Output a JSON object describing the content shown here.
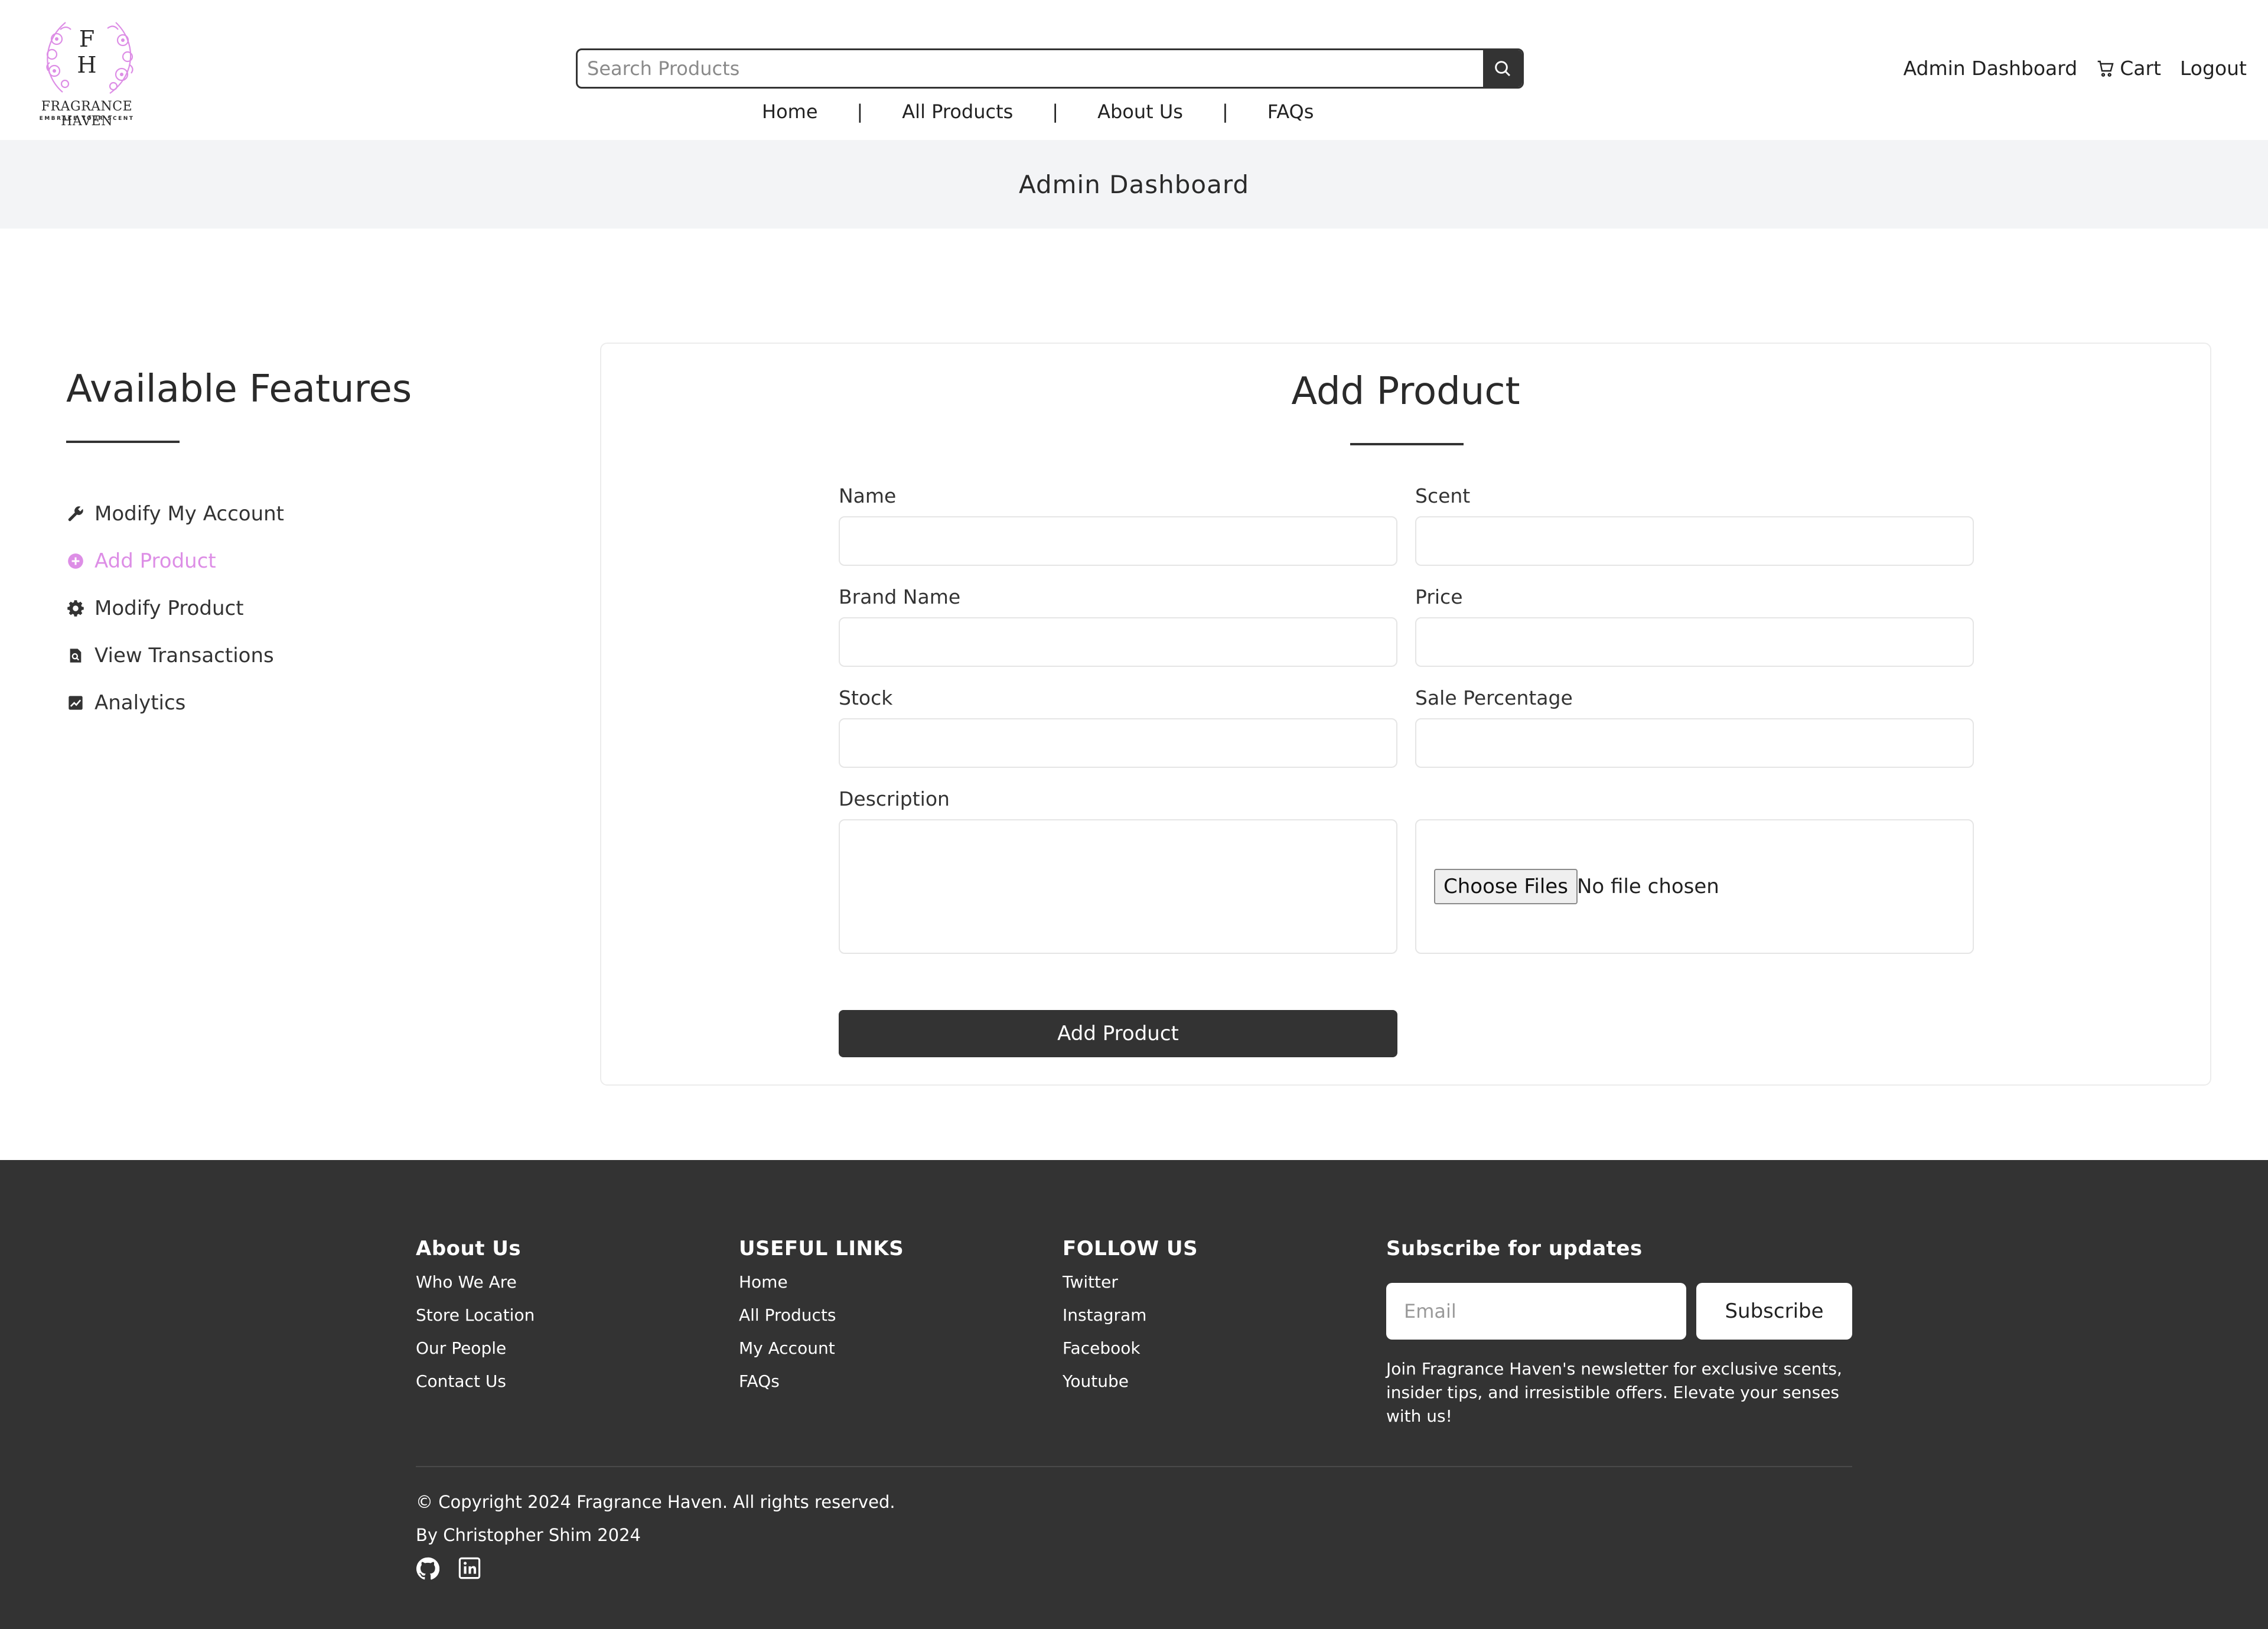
{
  "header": {
    "logo": {
      "mono_top": "F",
      "mono_bottom": "H",
      "brand": "FRAGRANCE HAVEN",
      "tagline": "EMBRACE YOUR SCENT",
      "icon": "floral-wreath-icon",
      "accent": "#dd8ee6"
    },
    "search": {
      "placeholder": "Search Products",
      "icon": "search-icon"
    },
    "nav": {
      "home": "Home",
      "all_products": "All Products",
      "about": "About Us",
      "faqs": "FAQs",
      "separator": "|"
    },
    "right": {
      "admin": "Admin Dashboard",
      "cart": "Cart",
      "cart_icon": "cart-icon",
      "logout": "Logout"
    }
  },
  "page_title": "Admin Dashboard",
  "sidebar": {
    "title": "Available Features",
    "items": [
      {
        "label": "Modify My Account",
        "icon": "wrench-icon",
        "active": false
      },
      {
        "label": "Add Product",
        "icon": "plus-circle-icon",
        "active": true
      },
      {
        "label": "Modify Product",
        "icon": "gear-icon",
        "active": false
      },
      {
        "label": "View Transactions",
        "icon": "receipt-search-icon",
        "active": false
      },
      {
        "label": "Analytics",
        "icon": "chart-icon",
        "active": false
      }
    ]
  },
  "form": {
    "title": "Add Product",
    "name_label": "Name",
    "scent_label": "Scent",
    "brand_label": "Brand Name",
    "price_label": "Price",
    "stock_label": "Stock",
    "sale_label": "Sale Percentage",
    "description_label": "Description",
    "file_button": "Choose Files",
    "file_status": "No file chosen",
    "submit": "Add Product"
  },
  "footer": {
    "about": {
      "title": "About Us",
      "links": [
        "Who We Are",
        "Store Location",
        "Our People",
        "Contact Us"
      ]
    },
    "useful": {
      "title": "USEFUL LINKS",
      "links": [
        "Home",
        "All Products",
        "My Account",
        "FAQs"
      ]
    },
    "follow": {
      "title": "FOLLOW US",
      "links": [
        "Twitter",
        "Instagram",
        "Facebook",
        "Youtube"
      ]
    },
    "subscribe": {
      "title": "Subscribe for updates",
      "placeholder": "Email",
      "button": "Subscribe",
      "text": "Join Fragrance Haven's newsletter for exclusive scents, insider tips, and irresistible offers. Elevate your senses with us!"
    },
    "copyright": "© Copyright 2024 Fragrance Haven. All rights reserved.",
    "by": "By Christopher Shim 2024",
    "social_icons": [
      "github-icon",
      "linkedin-icon"
    ]
  },
  "colors": {
    "dark": "#333333",
    "accent": "#dd8ee6",
    "title_bar": "#f3f4f6"
  }
}
